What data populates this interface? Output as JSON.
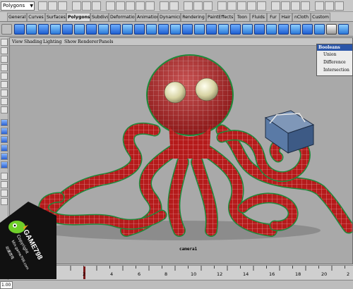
{
  "status_line": {
    "menu_set": "Polygons"
  },
  "shelf": {
    "tabs": [
      "General",
      "Curves",
      "Surfaces",
      "Polygons",
      "Subdivs",
      "Deformation",
      "Animation",
      "Dynamics",
      "Rendering",
      "PaintEffects",
      "Toon",
      "Fluids",
      "Fur",
      "Hair",
      "nCloth",
      "Custom"
    ],
    "active_tab": "Polygons"
  },
  "viewport": {
    "menu": [
      "View",
      "Shading",
      "Lighting",
      "Show",
      "Renderer",
      "Panels"
    ],
    "camera_label": "camera1"
  },
  "booleans_menu": {
    "title": "Booleans",
    "items": [
      "Union",
      "Difference",
      "Intersection"
    ]
  },
  "time_slider": {
    "ticks": [
      "2",
      "4",
      "6",
      "8",
      "10",
      "12",
      "14",
      "16",
      "18",
      "20",
      "2"
    ],
    "range_start": "1.00"
  },
  "watermark": {
    "brand": "GAME798",
    "copyright": "Copyright",
    "url": "bbs.game798.com",
    "extra": "动漫游戏"
  },
  "colors": {
    "octopus": "#b01818",
    "wire": "#2aff6a",
    "shelf_icon": "#2a6ad8",
    "viewport_bg": "#a9a9a9"
  }
}
